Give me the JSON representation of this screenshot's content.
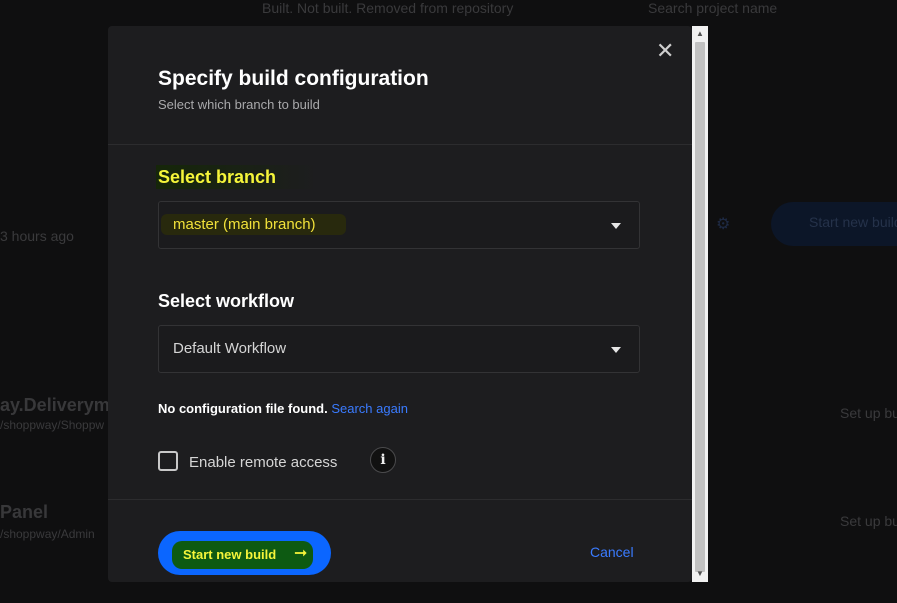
{
  "background": {
    "top_text": "Built. Not built. Removed from repository",
    "top_right_text": "Search project name",
    "time_ago": "3 hours ago",
    "project1_name": "ay.Deliverym",
    "project1_sub": "/shoppway/Shoppw",
    "project2_name": "Panel",
    "project2_sub": "/shoppway/Admin",
    "start_button": "Start new build",
    "setup1": "Set up bu",
    "setup2": "Set up bu"
  },
  "dialog": {
    "title": "Specify build configuration",
    "subtitle": "Select which branch to build",
    "branch_label": "Select branch",
    "branch_value": "master (main branch)",
    "workflow_label": "Select workflow",
    "workflow_value": "Default Workflow",
    "no_config_text": "No configuration file found.",
    "search_again": "Search again",
    "remote_access_label": "Enable remote access",
    "info_glyph": "i",
    "start_label": "Start new build",
    "arrow_glyph": "➞",
    "cancel_label": "Cancel",
    "close_glyph": "✕"
  },
  "scrollbar": {
    "up_glyph": "▲",
    "down_glyph": "▼"
  },
  "colors": {
    "accent": "#0b66ff",
    "link": "#3a7bff",
    "highlight_text": "#f5f53a",
    "modal_bg": "#1d1d1f"
  }
}
